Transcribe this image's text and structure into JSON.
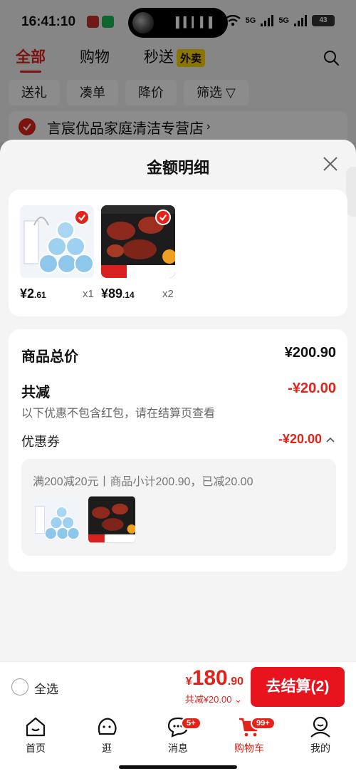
{
  "status_bar": {
    "time": "16:41:10",
    "network_1": "5G",
    "network_2": "5G",
    "battery": "43"
  },
  "background": {
    "tabs": [
      "全部",
      "购物",
      "秒送"
    ],
    "takeout_badge": "外卖",
    "chips": [
      "送礼",
      "凑单",
      "降价",
      "筛选"
    ],
    "store_name": "言宸优品家庭清洁专营店"
  },
  "sheet": {
    "title": "金额明细",
    "items": [
      {
        "price_int": "¥2",
        "price_dec": ".61",
        "qty": "x1"
      },
      {
        "price_int": "¥89",
        "price_dec": ".14",
        "qty": "x2"
      }
    ],
    "total_label": "商品总价",
    "total_value": "¥200.90",
    "reduce_label": "共减",
    "reduce_value": "-¥20.00",
    "note": "以下优惠不包含红包，请在结算页查看",
    "coupon_label": "优惠券",
    "coupon_value": "-¥20.00",
    "coupon_detail": "满200减20元丨商品小计200.90，已减20.00"
  },
  "checkout": {
    "select_all": "全选",
    "currency": "¥",
    "total_int": "180",
    "total_dec": ".90",
    "discount": "共减¥20.00",
    "button": "去结算(2)"
  },
  "tabbar": {
    "items": [
      {
        "label": "首页"
      },
      {
        "label": "逛"
      },
      {
        "label": "消息",
        "badge": "5+"
      },
      {
        "label": "购物车",
        "badge": "99+"
      },
      {
        "label": "我的"
      }
    ]
  },
  "colors": {
    "accent": "#e2231a",
    "sheet_bg": "#f4f4f4",
    "overlay": "#7f7f7f"
  }
}
